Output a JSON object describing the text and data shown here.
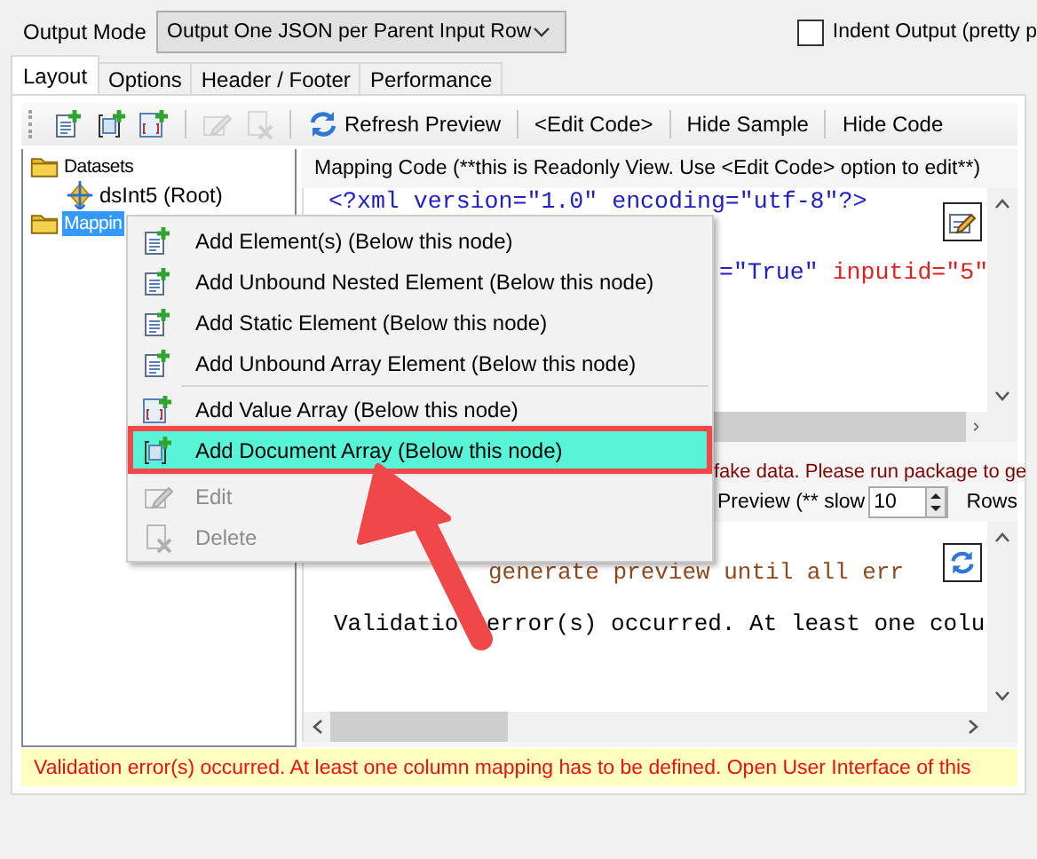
{
  "output_mode": {
    "label": "Output Mode",
    "value": "Output One JSON per Parent Input Row"
  },
  "indent_output": {
    "label": "Indent Output (pretty p",
    "checked": false
  },
  "tabs": [
    {
      "label": "Layout",
      "selected": true
    },
    {
      "label": "Options",
      "selected": false
    },
    {
      "label": "Header / Footer",
      "selected": false
    },
    {
      "label": "Performance",
      "selected": false
    }
  ],
  "toolbar": [
    {
      "kind": "icon",
      "disabled": false
    },
    {
      "kind": "icon",
      "disabled": false
    },
    {
      "kind": "icon",
      "disabled": false
    },
    {
      "kind": "icon",
      "disabled": true
    },
    {
      "kind": "icon",
      "disabled": true
    },
    {
      "kind": "text",
      "label": "Refresh Preview",
      "icon": true
    },
    {
      "kind": "text",
      "label": "<Edit Code>",
      "icon": false
    },
    {
      "kind": "text",
      "label": "Hide Sample",
      "icon": false
    },
    {
      "kind": "text",
      "label": "Hide Code",
      "icon": false
    }
  ],
  "tree": [
    {
      "kind": "folder",
      "label": "Datasets",
      "selected": false,
      "children": [
        {
          "kind": "dataset",
          "label": "dsInt5 (Root)",
          "selected": false
        }
      ]
    },
    {
      "kind": "folder",
      "label": "Mappin",
      "selected": true
    }
  ],
  "mapping_code": {
    "caption": "Mapping Code (**this is Readonly View. Use <Edit Code> option to edit**)",
    "lines": [
      {
        "parts": [
          {
            "kind": "value",
            "text": "<?xml version=\"1.0\" encoding=\"utf-8\"?>"
          }
        ]
      },
      {
        "parts": [
          {
            "kind": "value",
            "text": "=\"True\""
          },
          {
            "kind": "attribute",
            "text": "inputid=\"5\""
          }
        ]
      }
    ]
  },
  "sample_notice": "fake data. Please run package to ge",
  "preview": {
    "label": "Preview (** slow",
    "rows_value": "10",
    "rows_label": "Rows"
  },
  "output": {
    "lines": [
      {
        "kind": "notice",
        "parts": [
          "generate preview until all err"
        ]
      },
      {
        "kind": "plain",
        "parts": [
          "Validatio",
          "error(s) occurred. At least one colu"
        ]
      }
    ]
  },
  "status_bar": "Validation error(s) occurred. At least one column mapping has to be defined. Open User Interface of this",
  "context_menu": [
    {
      "kind": "item",
      "label": "Add Element(s) (Below this node)",
      "disabled": false,
      "selected": false
    },
    {
      "kind": "item",
      "label": "Add Unbound Nested Element (Below this node)",
      "disabled": false,
      "selected": false
    },
    {
      "kind": "item",
      "label": "Add Static Element (Below this node)",
      "disabled": false,
      "selected": false
    },
    {
      "kind": "item",
      "label": "Add Unbound Array Element (Below this node)",
      "disabled": false,
      "selected": false
    },
    {
      "kind": "separator"
    },
    {
      "kind": "item",
      "label": "Add Value Array (Below this node)",
      "disabled": false,
      "selected": false
    },
    {
      "kind": "item",
      "label": "Add Document Array (Below this node)",
      "disabled": false,
      "selected": true
    },
    {
      "kind": "separator"
    },
    {
      "kind": "item",
      "label": "Edit",
      "disabled": true,
      "selected": false
    },
    {
      "kind": "item",
      "label": "Delete",
      "disabled": true,
      "selected": false
    }
  ]
}
